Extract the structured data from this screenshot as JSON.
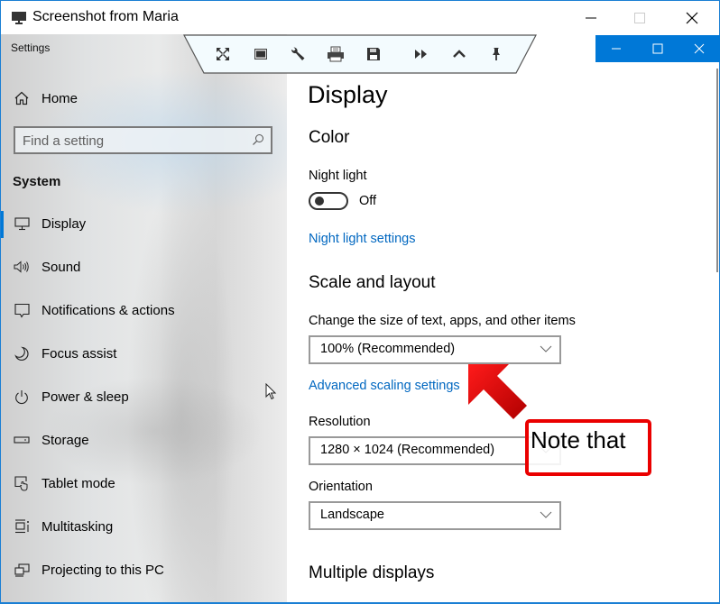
{
  "outer_window": {
    "title": "Screenshot from Maria",
    "icon": "monitor-icon",
    "controls": [
      "minimize-icon",
      "maximize-icon",
      "close-icon"
    ]
  },
  "toolbar": {
    "buttons": [
      {
        "name": "fullscreen",
        "icon": "fullscreen-icon"
      },
      {
        "name": "window",
        "icon": "window-icon"
      },
      {
        "name": "settings",
        "icon": "wrench-icon"
      },
      {
        "name": "print",
        "icon": "printer-icon"
      },
      {
        "name": "save",
        "icon": "floppy-disk-icon"
      },
      {
        "name": "fast-forward",
        "icon": "fast-forward-icon"
      },
      {
        "name": "collapse",
        "icon": "chevron-up-icon"
      },
      {
        "name": "pin",
        "icon": "pin-icon"
      }
    ]
  },
  "app": {
    "name": "Settings",
    "controls": [
      "minimize-icon",
      "maximize-icon",
      "close-icon"
    ],
    "accent_color": "#0078d7"
  },
  "sidebar": {
    "home_label": "Home",
    "search_placeholder": "Find a setting",
    "section": "System",
    "selected": "Display",
    "items": [
      {
        "label": "Display",
        "icon": "monitor-icon"
      },
      {
        "label": "Sound",
        "icon": "speaker-icon"
      },
      {
        "label": "Notifications & actions",
        "icon": "notification-icon"
      },
      {
        "label": "Focus assist",
        "icon": "moon-icon"
      },
      {
        "label": "Power & sleep",
        "icon": "power-icon"
      },
      {
        "label": "Storage",
        "icon": "storage-icon"
      },
      {
        "label": "Tablet mode",
        "icon": "tablet-mode-icon"
      },
      {
        "label": "Multitasking",
        "icon": "multitasking-icon"
      },
      {
        "label": "Projecting to this PC",
        "icon": "projecting-icon"
      }
    ]
  },
  "content": {
    "title": "Display",
    "color_heading": "Color",
    "night_light_label": "Night light",
    "night_light_state": "Off",
    "night_light_on": false,
    "night_light_link": "Night light settings",
    "scale_heading": "Scale and layout",
    "scale_label": "Change the size of text, apps, and other items",
    "scale_value": "100% (Recommended)",
    "advanced_scaling_link": "Advanced scaling settings",
    "resolution_label": "Resolution",
    "resolution_value": "1280 × 1024 (Recommended)",
    "orientation_label": "Orientation",
    "orientation_value": "Landscape",
    "multiple_displays_heading": "Multiple displays"
  },
  "annotation": {
    "note_text": "Note that",
    "color": "#ea0000"
  }
}
